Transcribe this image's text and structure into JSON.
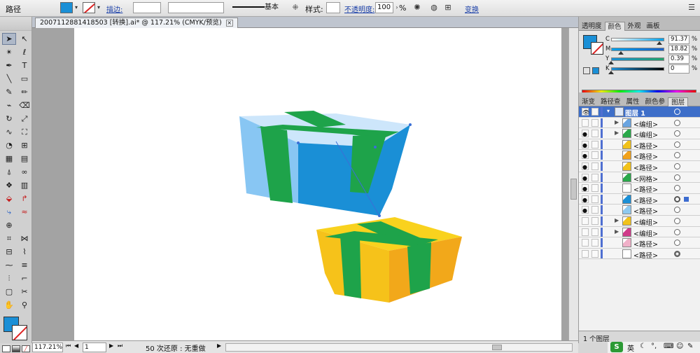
{
  "control_bar": {
    "object_type": "路径",
    "stroke_label": "描边:",
    "stroke_weight": "",
    "stroke_profile": "基本",
    "style_label": "样式:",
    "opacity_label": "不透明度:",
    "opacity_value": "100",
    "opacity_unit": "%",
    "transform_link": "变换",
    "fill_color": "#1a8fd6"
  },
  "document": {
    "tab_title": "2007112881418503 [转换].ai* @ 117.21% (CMYK/预览)",
    "close_icon": "close-icon"
  },
  "status_bar": {
    "zoom": "117.21%",
    "artboard_number": "1",
    "history_status": "50 次还原 : 无重做"
  },
  "color_panel": {
    "tabs": [
      "透明度",
      "颜色",
      "外观",
      "画板"
    ],
    "active_tab": "颜色",
    "fill_color": "#1a8fd6",
    "channels": [
      {
        "label": "C",
        "value": "91.37",
        "unit": "%",
        "level": 0.9137,
        "gradient": [
          "#ffffff",
          "#00a0e9"
        ]
      },
      {
        "label": "M",
        "value": "18.82",
        "unit": "%",
        "level": 0.1882,
        "gradient": [
          "#00a0e9",
          "#1a60c8"
        ]
      },
      {
        "label": "Y",
        "value": "0.39",
        "unit": "%",
        "level": 0.0039,
        "gradient": [
          "#1a8fd6",
          "#21a36a"
        ]
      },
      {
        "label": "K",
        "value": "0",
        "unit": "%",
        "level": 0.0,
        "gradient": [
          "#1a8fd6",
          "#000000"
        ]
      }
    ]
  },
  "layers_panel": {
    "tabs": [
      "渐变",
      "路径查",
      "属性",
      "颜色参",
      "图层"
    ],
    "active_tab": "图层",
    "top_layer": "图层 1",
    "rows": [
      {
        "name": "<编组>",
        "visible": false,
        "expandable": true,
        "thumb": "#6aa4e0",
        "target": "normal"
      },
      {
        "name": "<编组>",
        "visible": true,
        "expandable": true,
        "thumb": "#2aa84a",
        "target": "normal"
      },
      {
        "name": "<路径>",
        "visible": true,
        "expandable": false,
        "thumb": "#f1c21b",
        "target": "normal"
      },
      {
        "name": "<路径>",
        "visible": true,
        "expandable": false,
        "thumb": "#f1a21b",
        "target": "normal"
      },
      {
        "name": "<路径>",
        "visible": true,
        "expandable": false,
        "thumb": "#f1c21b",
        "target": "normal"
      },
      {
        "name": "<网格>",
        "visible": true,
        "expandable": false,
        "thumb": "#2aa84a",
        "target": "normal"
      },
      {
        "name": "<路径>",
        "visible": true,
        "expandable": false,
        "thumb": "#ffffff",
        "target": "normal"
      },
      {
        "name": "<路径>",
        "visible": true,
        "expandable": false,
        "thumb": "#1a8fd6",
        "target": "selected"
      },
      {
        "name": "<路径>",
        "visible": true,
        "expandable": false,
        "thumb": "#8ec9f0",
        "target": "normal"
      },
      {
        "name": "<编组>",
        "visible": false,
        "expandable": true,
        "thumb": "#f1c21b",
        "target": "normal"
      },
      {
        "name": "<编组>",
        "visible": false,
        "expandable": true,
        "thumb": "#d03a8a",
        "target": "normal"
      },
      {
        "name": "<路径>",
        "visible": false,
        "expandable": false,
        "thumb": "#f0b0c8",
        "target": "normal"
      },
      {
        "name": "<路径>",
        "visible": false,
        "expandable": false,
        "thumb": "#ffffff",
        "target": "filled"
      }
    ],
    "footer": "1 个图层"
  },
  "taskbar": {
    "ime_logo": "S",
    "ime_lang": "英"
  },
  "tools": [
    "selection-tool",
    "direct-selection-tool",
    "magic-wand-tool",
    "lasso-tool",
    "pen-tool",
    "type-tool",
    "line-tool",
    "rectangle-tool",
    "paintbrush-tool",
    "pencil-tool",
    "blob-brush-tool",
    "eraser-tool",
    "rotate-tool",
    "scale-tool",
    "warp-tool",
    "free-transform-tool",
    "shape-builder-tool",
    "perspective-grid-tool",
    "mesh-tool",
    "gradient-tool",
    "eyedropper-tool",
    "blend-tool",
    "symbol-sprayer-tool",
    "column-graph-tool",
    "artboard-tool",
    "slice-tool",
    "hand-tool",
    "zoom-tool"
  ]
}
